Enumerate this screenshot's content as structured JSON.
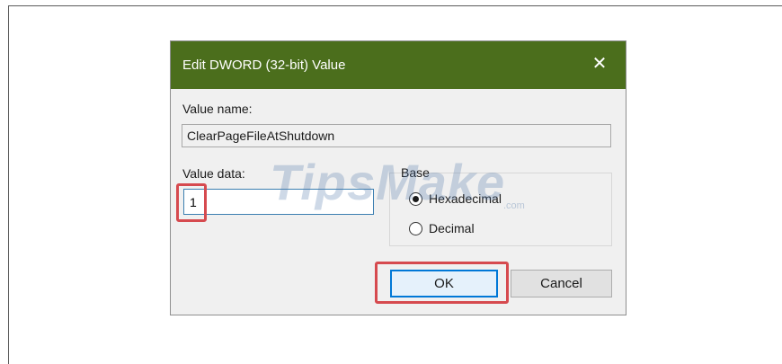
{
  "dialog": {
    "title": "Edit DWORD (32-bit) Value",
    "close_glyph": "✕",
    "value_name_label": "Value name:",
    "value_name": "ClearPageFileAtShutdown",
    "value_data_label": "Value data:",
    "value_data": "1",
    "base_label": "Base",
    "base_options": [
      {
        "label": "Hexadecimal",
        "selected": true
      },
      {
        "label": "Decimal",
        "selected": false
      }
    ],
    "ok_label": "OK",
    "cancel_label": "Cancel"
  },
  "watermark": {
    "text": "TipsMake",
    "suffix": ".com"
  },
  "colors": {
    "titlebar": "#4b6e1c",
    "highlight": "#d64a4f",
    "focus_border": "#0078d7"
  },
  "icons": [
    "close-icon"
  ]
}
